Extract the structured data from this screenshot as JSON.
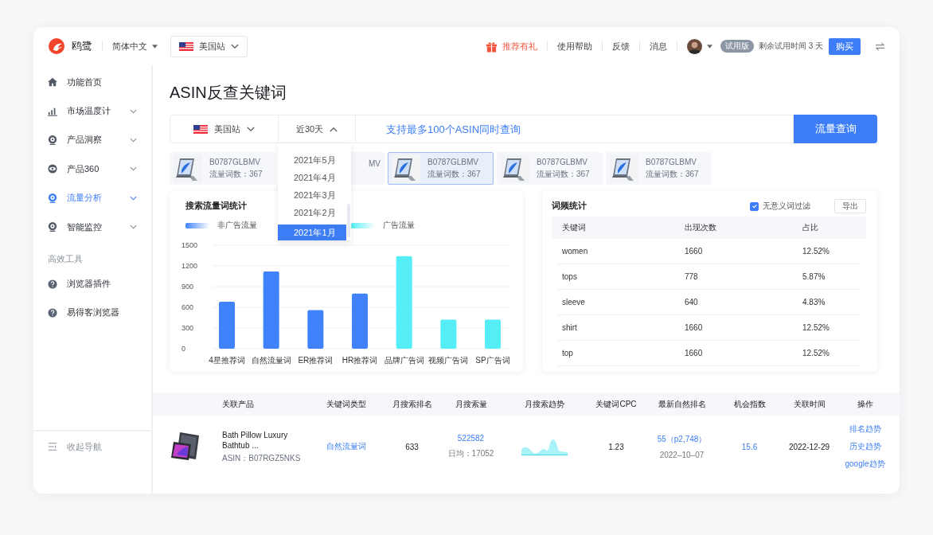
{
  "header": {
    "logo_text": "鸥鹭",
    "language": "简体中文",
    "site": "美国站",
    "nav": [
      {
        "label": "推荐有礼",
        "kind": "promo"
      },
      {
        "label": "使用帮助",
        "kind": "link"
      },
      {
        "label": "反馈",
        "kind": "link"
      },
      {
        "label": "消息",
        "kind": "link"
      }
    ],
    "badge": "试用版",
    "trial_text": "剩余试用时间 3 天",
    "buy_button": "购买"
  },
  "sidebar": {
    "items": [
      {
        "label": "功能首页",
        "kind": "link",
        "selected": false
      },
      {
        "label": "市场温度计",
        "kind": "menu",
        "selected": false
      },
      {
        "label": "产品洞察",
        "kind": "menu",
        "selected": false
      },
      {
        "label": "产品360",
        "kind": "menu",
        "selected": false
      },
      {
        "label": "流量分析",
        "kind": "menu",
        "selected": true
      },
      {
        "label": "智能监控",
        "kind": "menu",
        "selected": false
      }
    ],
    "section_title": "高效工具",
    "tools": [
      {
        "label": "浏览器插件"
      },
      {
        "label": "易得客浏览器"
      }
    ],
    "collapse": "收起导航"
  },
  "page_title": "ASIN反查关键词",
  "search": {
    "site": {
      "label": "美国站",
      "expanded": false
    },
    "period": {
      "label": "近30天",
      "expanded": true
    },
    "placeholder": "支持最多100个ASIN同时查询",
    "button": "流量查询"
  },
  "period_menu": [
    {
      "label": "2021年5月",
      "selected": false
    },
    {
      "label": "2021年4月",
      "selected": false
    },
    {
      "label": "2021年3月",
      "selected": false
    },
    {
      "label": "2021年2月",
      "selected": false
    },
    {
      "label": "2021年1月",
      "selected": true
    }
  ],
  "products": [
    {
      "kind": "full",
      "asin": "B0787GLBMV",
      "count": "流量词数：367",
      "selected": false
    },
    {
      "kind": "partial",
      "asin": "MV",
      "selected": false
    },
    {
      "kind": "full",
      "asin": "B0787GLBMV",
      "count": "流量词数：367",
      "selected": true
    },
    {
      "kind": "full",
      "asin": "B0787GLBMV",
      "count": "流量词数：367",
      "selected": false
    },
    {
      "kind": "full",
      "asin": "B0787GLBMV",
      "count": "流量词数：367",
      "selected": false
    }
  ],
  "traffic_chart": {
    "title": "搜索流量词统计",
    "chart_data": {
      "type": "bar",
      "categories": [
        "4星推荐词",
        "自然流量词",
        "ER推荐词",
        "HR推荐词",
        "品牌广告词",
        "视频广告词",
        "SP广告词"
      ],
      "series": [
        {
          "name": "非广告流量",
          "color": "#3f82fb",
          "values": [
            680,
            1120,
            560,
            800,
            null,
            null,
            null
          ]
        },
        {
          "name": "广告流量",
          "color": "#55eef6",
          "values": [
            null,
            null,
            null,
            null,
            1340,
            420,
            420
          ]
        }
      ],
      "grid": true,
      "ylim": [
        0,
        1500
      ],
      "yticks": [
        0,
        300,
        600,
        900,
        1200,
        1500
      ]
    }
  },
  "word_freq": {
    "title": "词频统计",
    "filter": {
      "label": "无意义词过滤",
      "checked": true
    },
    "export_button": "导出",
    "columns": [
      "关键词",
      "出现次数",
      "占比"
    ],
    "rows": [
      [
        "women",
        "1660",
        "12.52%"
      ],
      [
        "tops",
        "778",
        "5.87%"
      ],
      [
        "sleeve",
        "640",
        "4.83%"
      ],
      [
        "shirt",
        "1660",
        "12.52%"
      ],
      [
        "top",
        "1660",
        "12.52%"
      ]
    ]
  },
  "results": {
    "columns": [
      "关联产品",
      "关键词类型",
      "月搜索排名",
      "月搜索量",
      "月搜索趋势",
      "关键词CPC",
      "最新自然排名",
      "机会指数",
      "关联时间",
      "操作"
    ],
    "rows": [
      {
        "title": "Bath Pillow Luxury Bathtub ...",
        "asin": "ASIN：B07RGZ5NKS",
        "keyword_type": "自然流量词",
        "monthly_rank": "633",
        "monthly_volume": "522582",
        "daily_avg": "日均：17052",
        "cpc": "1.23",
        "natural_rank": "55（p2,748）",
        "natural_date": "2022–10–07",
        "opportunity": "15.6",
        "time": "2022-12-29",
        "actions": [
          "排名趋势",
          "历史趋势",
          "google趋势"
        ]
      }
    ]
  }
}
